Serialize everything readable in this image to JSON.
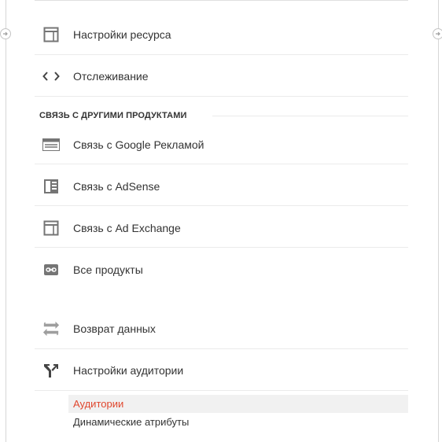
{
  "menu": {
    "items": [
      {
        "label": "Настройки ресурса",
        "icon": "property-settings-icon"
      },
      {
        "label": "Отслеживание",
        "icon": "code-brackets-icon"
      }
    ],
    "section_heading": "СВЯЗЬ С ДРУГИМИ ПРОДУКТАМИ",
    "linked_products": [
      {
        "label": "Связь с Google Рекламой",
        "icon": "google-ads-icon"
      },
      {
        "label": "Связь с AdSense",
        "icon": "adsense-icon"
      },
      {
        "label": "Связь с Ad Exchange",
        "icon": "ad-exchange-icon"
      },
      {
        "label": "Все продукты",
        "icon": "link-icon"
      }
    ],
    "other_items": [
      {
        "label": "Возврат данных",
        "icon": "data-return-icon"
      },
      {
        "label": "Настройки аудитории",
        "icon": "audience-fork-icon"
      }
    ],
    "audience_subitems": [
      {
        "label": "Аудитории",
        "active": true
      },
      {
        "label": "Динамические атрибуты",
        "active": false
      }
    ]
  },
  "colors": {
    "active_text": "#e0472e",
    "icon_gray": "#757575",
    "text": "#333333",
    "divider": "#ebebeb"
  }
}
